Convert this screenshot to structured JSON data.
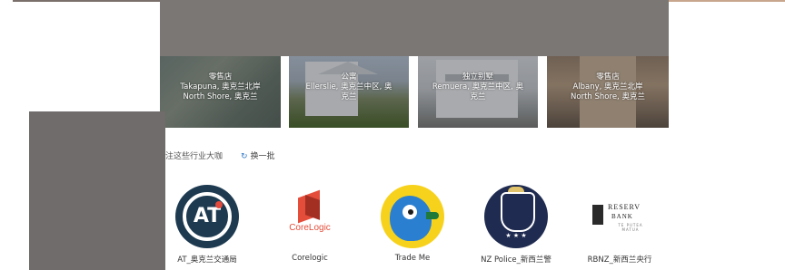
{
  "listings": [
    {
      "type": "零售店",
      "location": "Takapuna, 奥克兰北岸",
      "sublocation": "North Shore, 奥克兰"
    },
    {
      "type": "公寓",
      "location": "Ellerslie, 奥克兰中区, 奥",
      "sublocation": "克兰"
    },
    {
      "type": "独立别墅",
      "location": "Remuera, 奥克兰中区, 奥",
      "sublocation": "克兰"
    },
    {
      "type": "零售店",
      "location": "Albany, 奥克兰北岸",
      "sublocation": "North Shore, 奥克兰"
    }
  ],
  "hint_text": "注这些行业大咖",
  "refresh_label": "换一批",
  "refresh_icon": "refresh-icon",
  "brands": [
    {
      "name": "AT_奥克兰交通局",
      "logo_text": "AT"
    },
    {
      "name": "Corelogic",
      "logo_text": "CoreLogic"
    },
    {
      "name": "Trade Me"
    },
    {
      "name": "NZ Police_新西兰警",
      "logo_text": "★ ★ ★"
    },
    {
      "name": "RBNZ_新西兰央行",
      "logo_text_1": "RESERV",
      "logo_text_2": "BANK",
      "logo_text_3": "TE PUTEA MATUA"
    }
  ]
}
